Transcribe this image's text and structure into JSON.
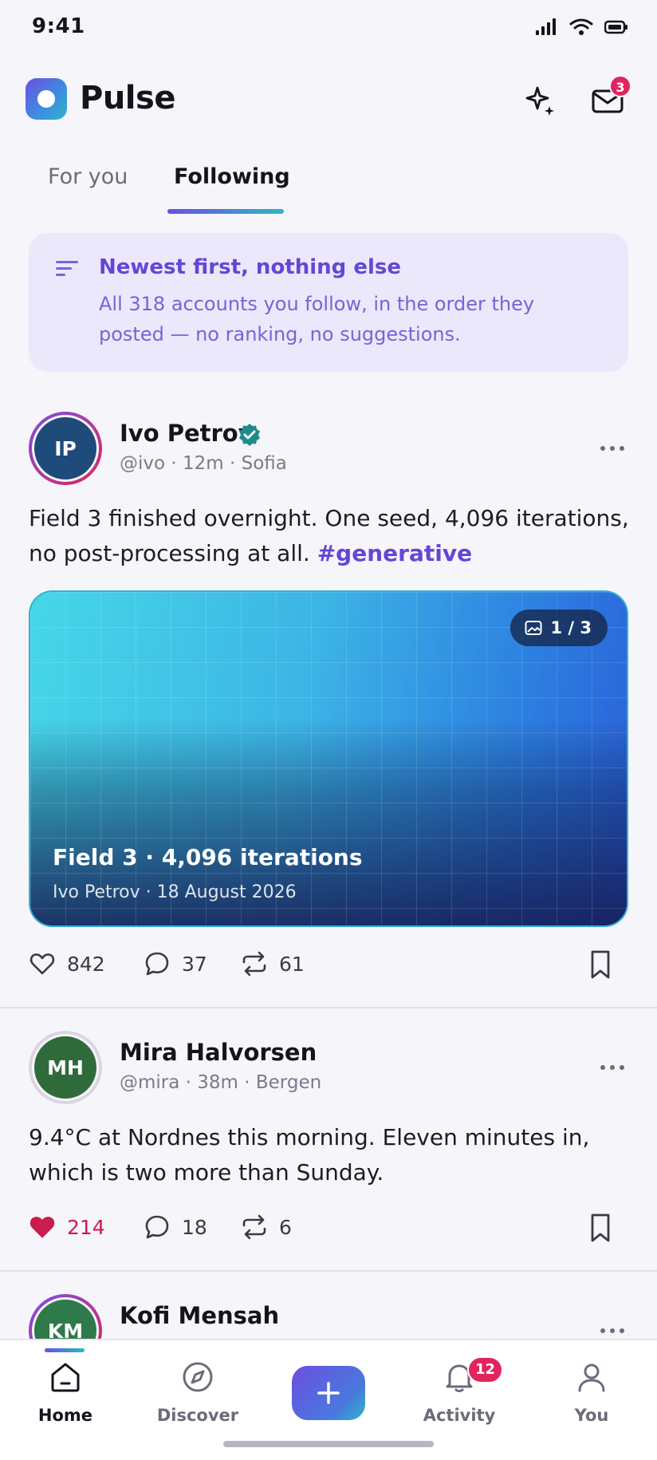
{
  "status_bar": {
    "time": "9:41"
  },
  "header": {
    "title": "Pulse",
    "messages_badge": "3"
  },
  "tabs": [
    {
      "label": "For you",
      "active": false
    },
    {
      "label": "Following",
      "active": true
    }
  ],
  "banner": {
    "title": "Newest first, nothing else",
    "text": "All 318 accounts you follow, in the order they posted — no ranking, no suggestions."
  },
  "posts": [
    {
      "initials": "IP",
      "author": "Ivo Petrov",
      "verified": true,
      "meta": "@ivo · 12m · Sofia",
      "text": "Field 3 finished overnight. One seed, 4,096 iterations, no post-processing at all.",
      "hashtag": "#generative",
      "media": {
        "counter": "1 / 3",
        "title": "Field 3 · 4,096 iterations",
        "caption": "Ivo Petrov · 18 August 2026"
      },
      "likes": "842",
      "comments": "37",
      "reposts": "61",
      "liked": false,
      "avatar_color": "#1f4b7a"
    },
    {
      "initials": "MH",
      "author": "Mira Halvorsen",
      "verified": false,
      "meta": "@mira · 38m · Bergen",
      "text": "9.4°C at Nordnes this morning. Eleven minutes in, which is two more than Sunday.",
      "likes": "214",
      "comments": "18",
      "reposts": "6",
      "liked": true,
      "avatar_color": "#2f6b3a"
    },
    {
      "initials": "KM",
      "author": "Kofi Mensah",
      "avatar_color": "#2f7a4a"
    }
  ],
  "nav": {
    "home": "Home",
    "discover": "Discover",
    "activity": "Activity",
    "you": "You",
    "activity_badge": "12"
  },
  "colors": {
    "accent": "#6446d6",
    "like": "#c81d4e",
    "badge": "#e0245e",
    "verified": "#1f8a8a"
  }
}
